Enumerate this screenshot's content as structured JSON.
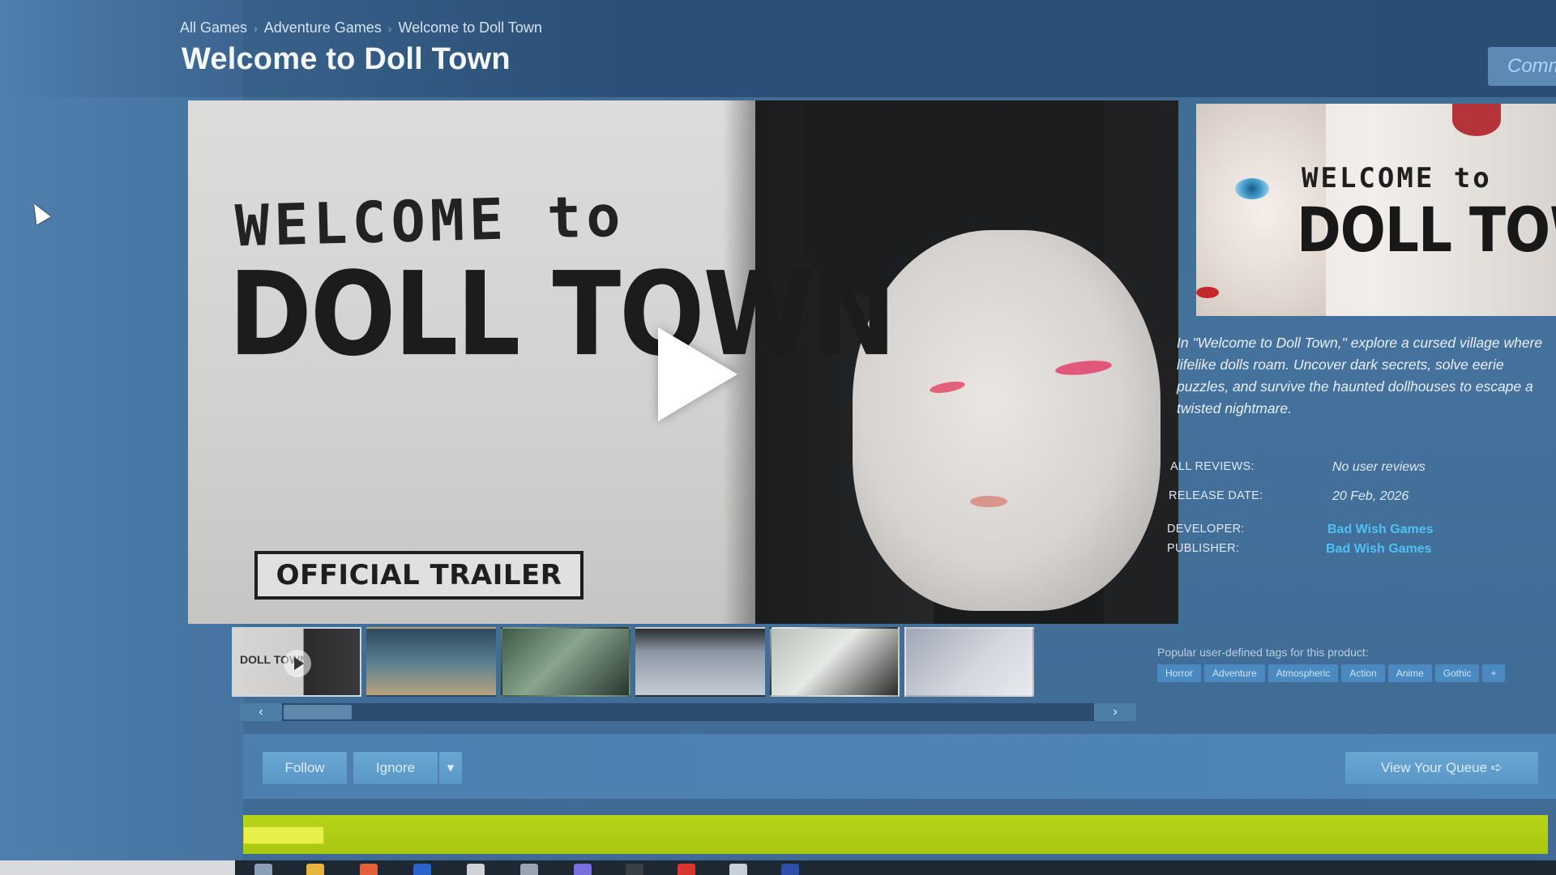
{
  "breadcrumb": [
    "All Games",
    "Adventure Games",
    "Welcome to Doll Town"
  ],
  "title": "Welcome to Doll Town",
  "community_button": "Comm",
  "media": {
    "logo_line1": "WELCOME to",
    "logo_line2": "DOLL TOWN",
    "trailer_label": "OFFICIAL TRAILER",
    "thumb_logo_text": "DOLL TOWN"
  },
  "capsule": {
    "logo_line1": "WELCOME to",
    "logo_line2": "DOLL TOWN"
  },
  "description": "In \"Welcome to Doll Town,\" explore a cursed village where lifelike dolls roam. Uncover dark secrets, solve eerie puzzles, and survive the haunted dollhouses to escape a twisted nightmare.",
  "info": {
    "all_reviews_label": "ALL REVIEWS:",
    "all_reviews_value": "No user reviews",
    "release_label": "RELEASE DATE:",
    "release_value": "20 Feb, 2026",
    "developer_label": "DEVELOPER:",
    "developer_value": "Bad Wish Games",
    "publisher_label": "PUBLISHER:",
    "publisher_value": "Bad Wish Games"
  },
  "tags": {
    "label": "Popular user-defined tags for this product:",
    "items": [
      "Horror",
      "Adventure",
      "Atmospheric",
      "Action",
      "Anime",
      "Gothic",
      "+"
    ]
  },
  "carousel": {
    "prev": "‹",
    "next": "›"
  },
  "actions": {
    "follow": "Follow",
    "ignore": "Ignore",
    "dropdown": "▾",
    "view_queue": "View Your Queue ➪"
  }
}
